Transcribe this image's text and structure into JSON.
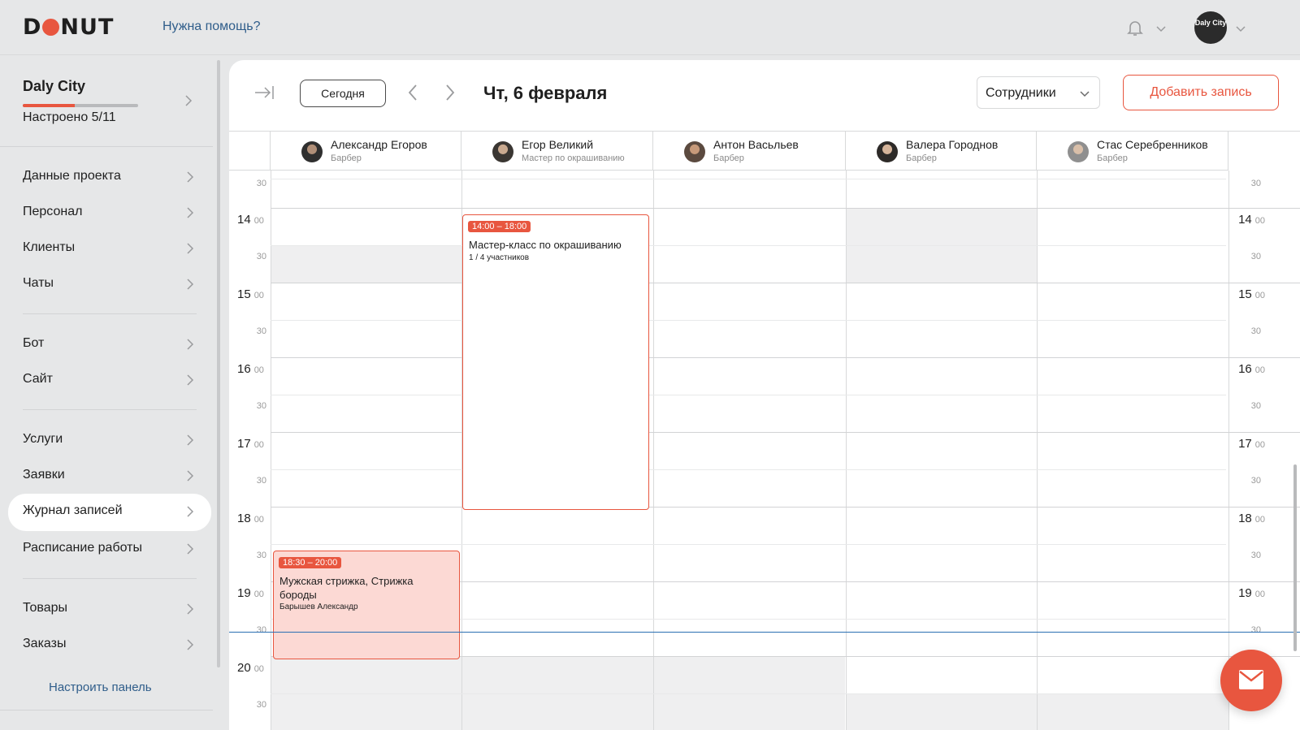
{
  "header": {
    "logo_left": "D",
    "logo_right": "NUT",
    "help_link": "Нужна помощь?",
    "avatar_text": "Daly City"
  },
  "sidebar": {
    "project_name": "Daly City",
    "setup_progress": 0.45,
    "setup_status": "Настроено 5/11",
    "items": [
      {
        "label": "Данные проекта"
      },
      {
        "label": "Персонал"
      },
      {
        "label": "Клиенты"
      },
      {
        "label": "Чаты"
      },
      {
        "label": "Бот"
      },
      {
        "label": "Сайт"
      },
      {
        "label": "Услуги"
      },
      {
        "label": "Заявки"
      },
      {
        "label": "Журнал записей",
        "active": true
      },
      {
        "label": "Расписание работы"
      },
      {
        "label": "Товары"
      },
      {
        "label": "Заказы"
      }
    ],
    "configure_link": "Настроить панель"
  },
  "toolbar": {
    "today_label": "Сегодня",
    "date_title": "Чт, 6 февраля",
    "staff_filter": "Сотрудники",
    "add_label": "Добавить запись"
  },
  "staff": [
    {
      "name": "Александр Егоров",
      "role": "Барбер"
    },
    {
      "name": "Егор Великий",
      "role": "Мастер по окрашиванию"
    },
    {
      "name": "Антон Васьльев",
      "role": "Барбер"
    },
    {
      "name": "Валера Городнов",
      "role": "Барбер"
    },
    {
      "name": "Стас Серебренников",
      "role": "Барбер"
    }
  ],
  "times": {
    "half": "30",
    "minutes": "00",
    "hours": [
      "14",
      "15",
      "16",
      "17",
      "18",
      "19",
      "20"
    ]
  },
  "events": [
    {
      "time": "14:00 – 18:00",
      "title": "Мастер-класс по окрашиванию",
      "subtitle": "1 / 4 участников",
      "staff_index": 1
    },
    {
      "time": "18:30 – 20:00",
      "title": "Мужская стрижка, Стрижка бороды",
      "subtitle": "Барышев Александр",
      "staff_index": 0
    }
  ],
  "colors": {
    "accent": "#e8563f",
    "link": "#2f5d8a",
    "now_line": "#2a6fb3",
    "event_fill": "#fcd9d4"
  }
}
